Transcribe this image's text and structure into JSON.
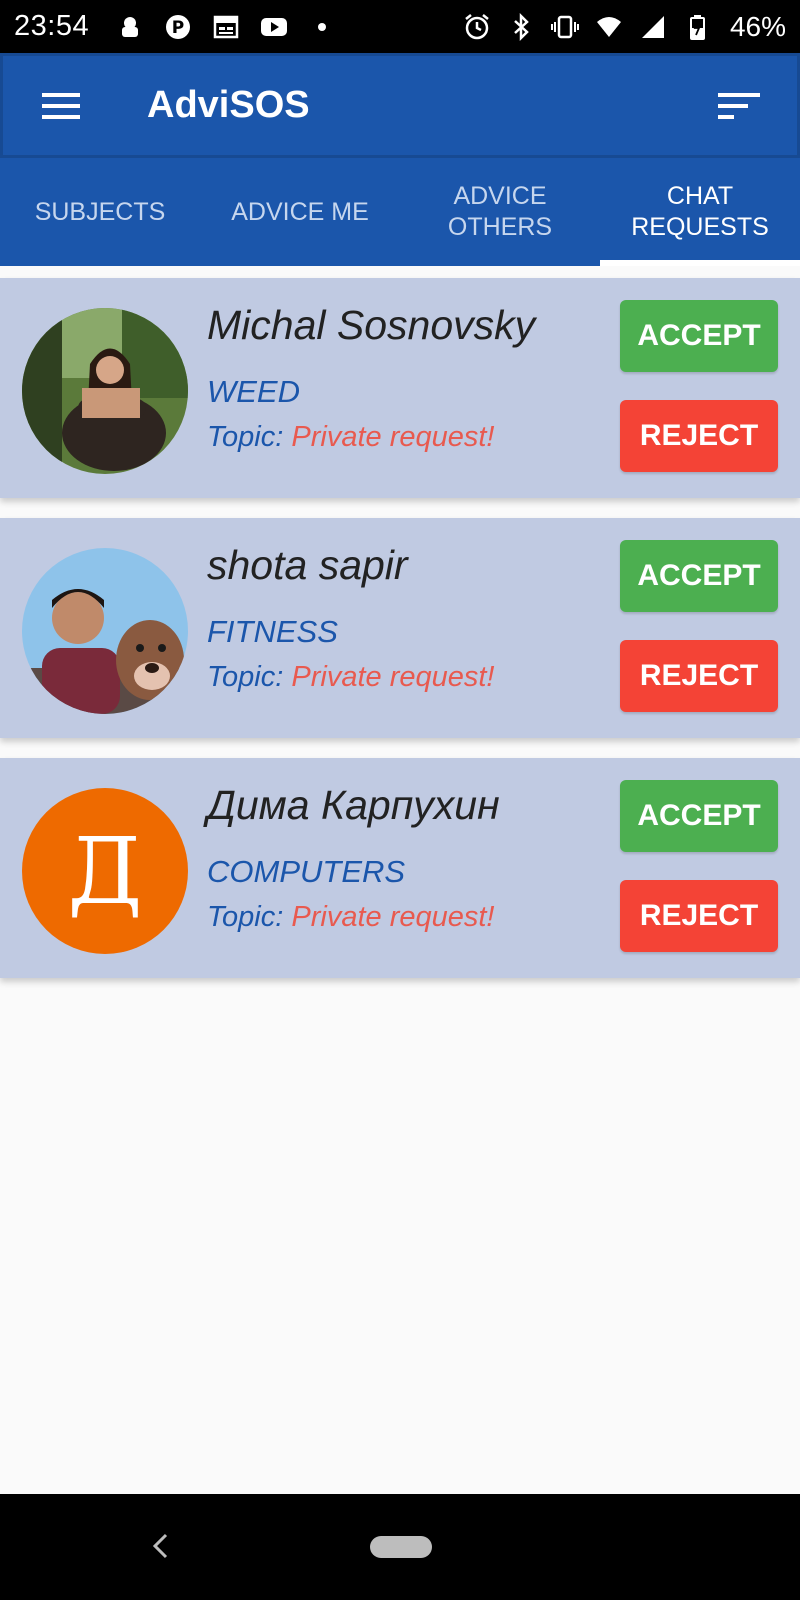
{
  "status_bar": {
    "time": "23:54",
    "battery": "46%",
    "left_icons": [
      "android-head-icon",
      "parking-icon",
      "calendar-icon",
      "youtube-icon",
      "dot-icon"
    ],
    "right_icons": [
      "alarm-icon",
      "bluetooth-icon",
      "vibrate-icon",
      "wifi-icon",
      "signal-icon",
      "battery-icon"
    ]
  },
  "app_bar": {
    "title": "AdviSOS",
    "menu_icon": "hamburger-menu-icon",
    "sort_icon": "sort-icon"
  },
  "tabs": [
    {
      "label": "SUBJECTS",
      "active": false
    },
    {
      "label": "ADVICE ME",
      "active": false
    },
    {
      "label": "ADVICE OTHERS",
      "active": false
    },
    {
      "label": "CHAT REQUESTS",
      "active": true
    }
  ],
  "requests": [
    {
      "name": "Michal Sosnovsky",
      "subject": "WEED",
      "topic_label": "Topic:",
      "topic_value": "Private request!",
      "accept": "ACCEPT",
      "reject": "REJECT",
      "avatar": "photo"
    },
    {
      "name": "shota sapir",
      "subject": "FITNESS",
      "topic_label": "Topic:",
      "topic_value": "Private request!",
      "accept": "ACCEPT",
      "reject": "REJECT",
      "avatar": "photo"
    },
    {
      "name": "Дима Карпухин",
      "subject": "COMPUTERS",
      "topic_label": "Topic:",
      "topic_value": "Private request!",
      "accept": "ACCEPT",
      "reject": "REJECT",
      "avatar": "letter",
      "avatar_letter": "Д"
    }
  ],
  "colors": {
    "primary": "#1b56ab",
    "card": "#c0cae2",
    "accept": "#4caf50",
    "reject": "#f44336",
    "topic_value": "#e85a4f",
    "avatar_letter_bg": "#ee6a00"
  }
}
